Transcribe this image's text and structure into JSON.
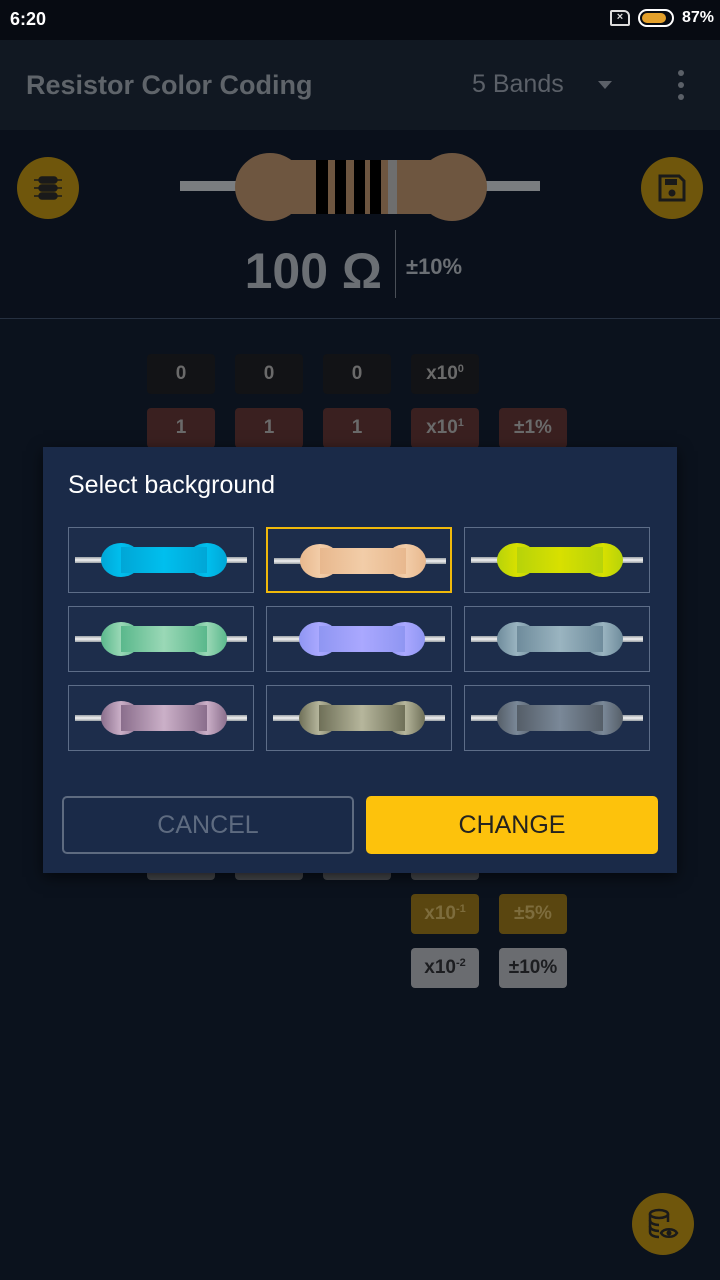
{
  "status_bar": {
    "time": "6:20",
    "sim_icon": "sim-x-icon",
    "battery_percent": "87%",
    "battery_level": 0.87
  },
  "appbar": {
    "title": "Resistor Color Coding",
    "band_select": "5 Bands",
    "menu_icon": "more-vert-icon"
  },
  "header": {
    "value": "100 Ω",
    "tolerance": "±10%",
    "left_button_icon": "resistor-list-icon",
    "right_button_icon": "save-icon",
    "resistor_colors": {
      "body": "#6e5640",
      "bands": [
        "#000000",
        "#000000",
        "#000000",
        "#000000",
        "#6e6e6e"
      ]
    }
  },
  "bands": {
    "rows": [
      {
        "color": "black",
        "digits": [
          "0",
          "0",
          "0"
        ],
        "multiplier_base": "x10",
        "multiplier_exp": "0",
        "tolerance": ""
      },
      {
        "color": "brown",
        "digits": [
          "1",
          "1",
          "1"
        ],
        "multiplier_base": "x10",
        "multiplier_exp": "1",
        "tolerance": "±1%"
      },
      {
        "color": "gold",
        "digits": [],
        "multiplier_base": "x10",
        "multiplier_exp": "-1",
        "tolerance": "±5%"
      },
      {
        "color": "silver",
        "digits": [],
        "multiplier_base": "x10",
        "multiplier_exp": "-2",
        "tolerance": "±10%"
      }
    ]
  },
  "dialog": {
    "title": "Select background",
    "options": [
      {
        "name": "blue",
        "edge": "#00a6d6",
        "mid": "#00bfee",
        "selected": false
      },
      {
        "name": "beige",
        "edge": "#e8b88e",
        "mid": "#f2cda8",
        "selected": true
      },
      {
        "name": "lime",
        "edge": "#b7d30a",
        "mid": "#d8e000",
        "selected": false
      },
      {
        "name": "green",
        "edge": "#5ab88c",
        "mid": "#9ad8b6",
        "selected": false
      },
      {
        "name": "lavender",
        "edge": "#8f96f2",
        "mid": "#aaa8ff",
        "selected": false
      },
      {
        "name": "steel-blue",
        "edge": "#6f8c9c",
        "mid": "#9ab4c0",
        "selected": false
      },
      {
        "name": "mauve",
        "edge": "#8a6e8c",
        "mid": "#cbb0c8",
        "selected": false
      },
      {
        "name": "khaki",
        "edge": "#6f7058",
        "mid": "#b6b69c",
        "selected": false
      },
      {
        "name": "slate",
        "edge": "#555e68",
        "mid": "#7a8898",
        "selected": false
      }
    ],
    "cancel_label": "CANCEL",
    "change_label": "CHANGE"
  },
  "fab": {
    "icon": "database-eye-icon"
  },
  "colors": {
    "accent": "#fdc20c",
    "dialog_bg": "#1a2a48",
    "app_bg": "#0b121d"
  }
}
